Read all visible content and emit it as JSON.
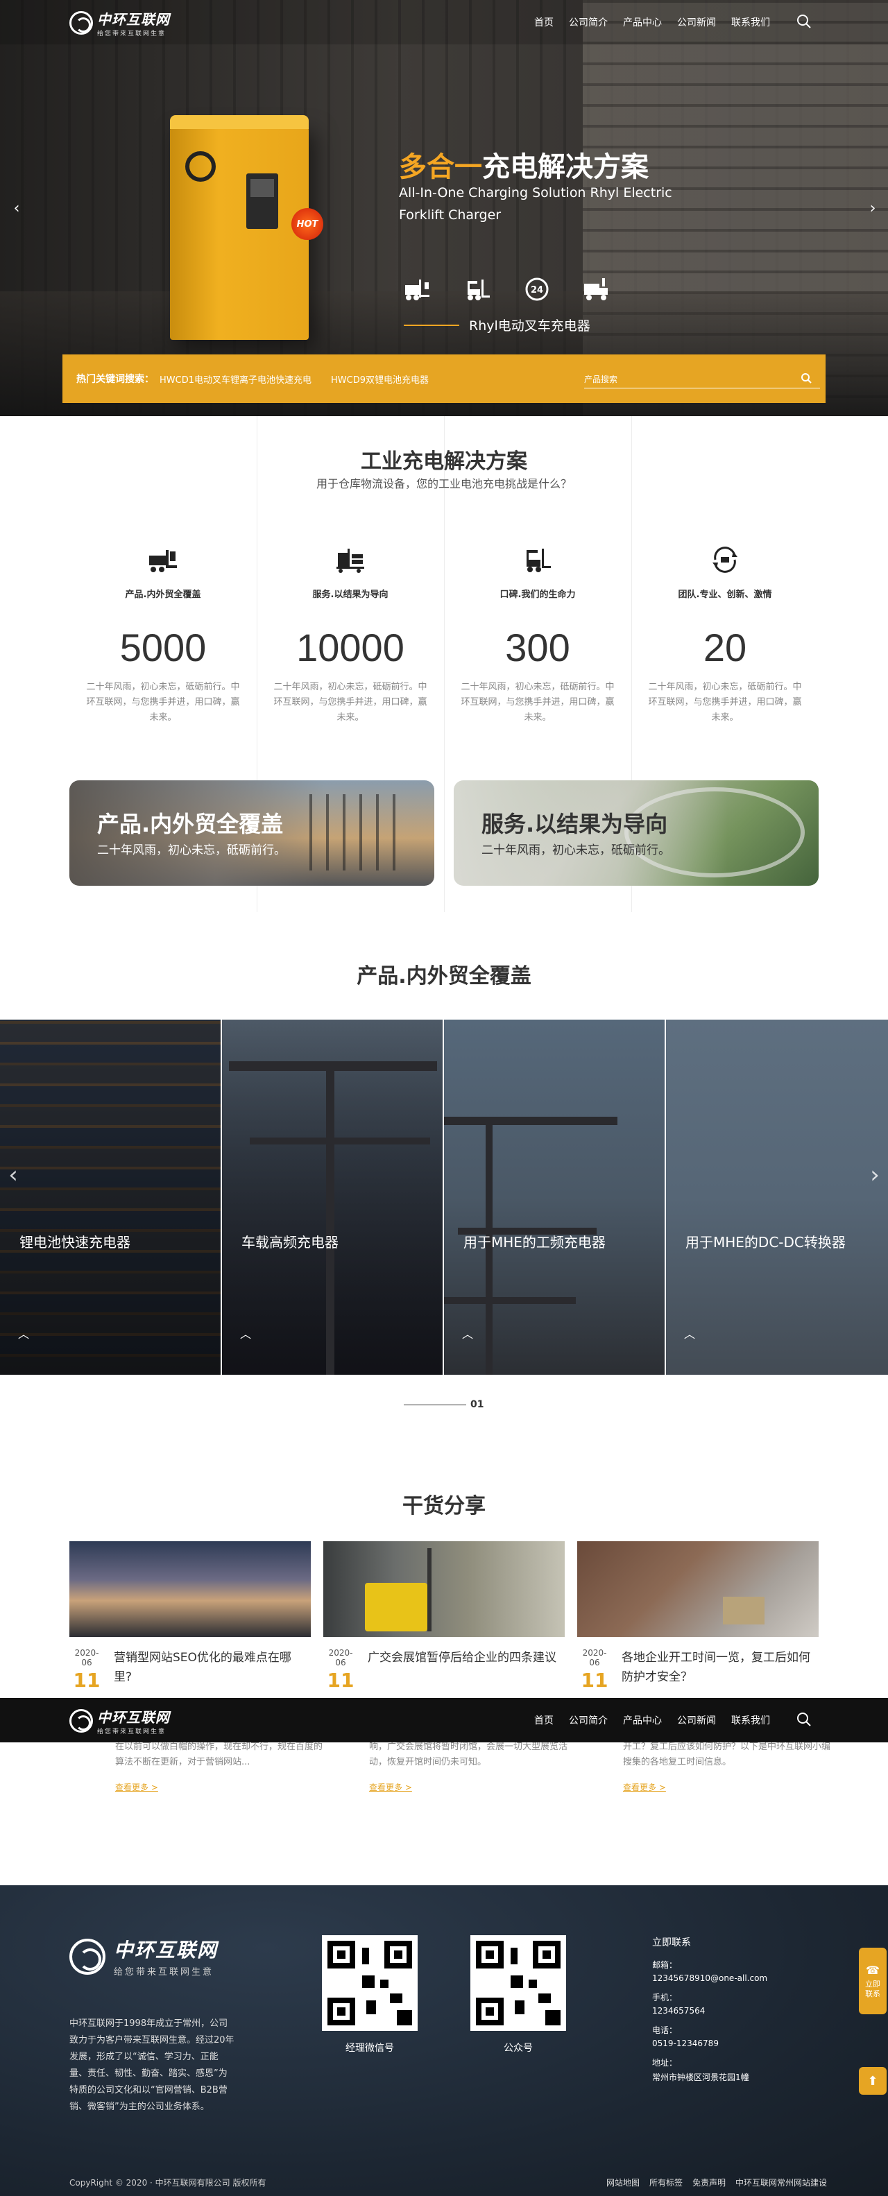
{
  "brand": {
    "name": "中环互联网",
    "slogan": "给您带来互联网生意"
  },
  "nav": {
    "items": [
      "首页",
      "公司简介",
      "产品中心",
      "公司新闻",
      "联系我们"
    ]
  },
  "hero": {
    "title_accent": "多合一",
    "title_rest": "充电解决方案",
    "subtitle": "All-In-One Charging Solution Rhyl Electric Forklift Charger",
    "caption": "Rhyl电动叉车充电器",
    "badge": "HOT",
    "icons": [
      "forklift-plug-icon",
      "forklift-icon",
      "24h-icon",
      "truck-icon"
    ]
  },
  "hotbar": {
    "label": "热门关键词搜索：",
    "links": [
      "HWCD1电动叉车锂离子电池快速充电",
      "HWCD9双锂电池充电器"
    ],
    "search_placeholder": "产品搜索"
  },
  "solutions": {
    "title": "工业充电解决方案",
    "subtitle": "用于仓库物流设备，您的工业电池充电挑战是什么？",
    "stats": [
      {
        "icon": "truck-icon",
        "title": "产品.内外贸全覆盖",
        "number": "5000",
        "desc": "二十年风雨，初心未忘，砥砺前行。中环互联网，与您携手并进，用口碑，赢未来。"
      },
      {
        "icon": "pallet-truck-icon",
        "title": "服务.以结果为导向",
        "number": "10000",
        "desc": "二十年风雨，初心未忘，砥砺前行。中环互联网，与您携手并进，用口碑，赢未来。"
      },
      {
        "icon": "forklift-icon",
        "title": "口碑.我们的生命力",
        "number": "300",
        "desc": "二十年风雨，初心未忘，砥砺前行。中环互联网，与您携手并进，用口碑，赢未来。"
      },
      {
        "icon": "team-cycle-icon",
        "title": "团队.专业、创新、激情",
        "number": "20",
        "desc": "二十年风雨，初心未忘，砥砺前行。中环互联网，与您携手并进，用口碑，赢未来。"
      }
    ],
    "promos": [
      {
        "title": "产品.内外贸全覆盖",
        "desc": "二十年风雨，初心未忘，砥砺前行。"
      },
      {
        "title": "服务.以结果为导向",
        "desc": "二十年风雨，初心未忘，砥砺前行。"
      }
    ]
  },
  "products": {
    "title": "产品.内外贸全覆盖",
    "items": [
      "锂电池快速充电器",
      "车载高频充电器",
      "用于MHE的工频充电器",
      "用于MHE的DC-DC转换器"
    ],
    "pager": "01"
  },
  "news": {
    "title": "干货分享",
    "items": [
      {
        "ym": "2020-06",
        "day": "11",
        "title": "营销型网站SEO优化的最难点在哪里?",
        "excerpt": "在以前可以做白帽的操作，现在却不行，规在百度的算法不断在更新，对于营销网站...",
        "more": "查看更多 >"
      },
      {
        "ym": "2020-06",
        "day": "11",
        "title": "广交会展馆暂停后给企业的四条建议",
        "excerpt": "响，广交会展馆将暂时闭馆，会展一切大型展览活动，恢复开馆时间仍未可知。",
        "more": "查看更多 >"
      },
      {
        "ym": "2020-06",
        "day": "11",
        "title": "各地企业开工时间一览，复工后如何防护才安全？",
        "excerpt": "开工？复工后应该如何防护？以下是中环互联网小编搜集的各地复工时间信息。",
        "more": "查看更多 >"
      }
    ]
  },
  "footer": {
    "about": "中环互联网于1998年成立于常州，公司致力于为客户带来互联网生意。经过20年发展，形成了以“诚信、学习力、正能量、责任、韧性、勤奋、踏实、感恩”为特质的公司文化和以“官网营销、B2B营销、微客销”为主的公司业务体系。",
    "qr": [
      "经理微信号",
      "公众号"
    ],
    "contact_title": "立即联系",
    "contact": [
      {
        "label": "邮箱：",
        "value": "12345678910@one-all.com"
      },
      {
        "label": "手机：",
        "value": "1234657564"
      },
      {
        "label": "电话：",
        "value": "0519-12346789"
      },
      {
        "label": "地址：",
        "value": "常州市钟楼区河景花园1幢"
      }
    ],
    "copyright": "CopyRight © 2020 ·  中环互联网有限公司  版权所有",
    "links": [
      "网站地图",
      "所有标签",
      "免责声明",
      "中环互联网常州网站建设"
    ]
  },
  "side": {
    "contact_label": "立即联系"
  },
  "colors": {
    "accent": "#e6a523",
    "footer_bg": "#1d2733",
    "header_dark": "#111111"
  }
}
